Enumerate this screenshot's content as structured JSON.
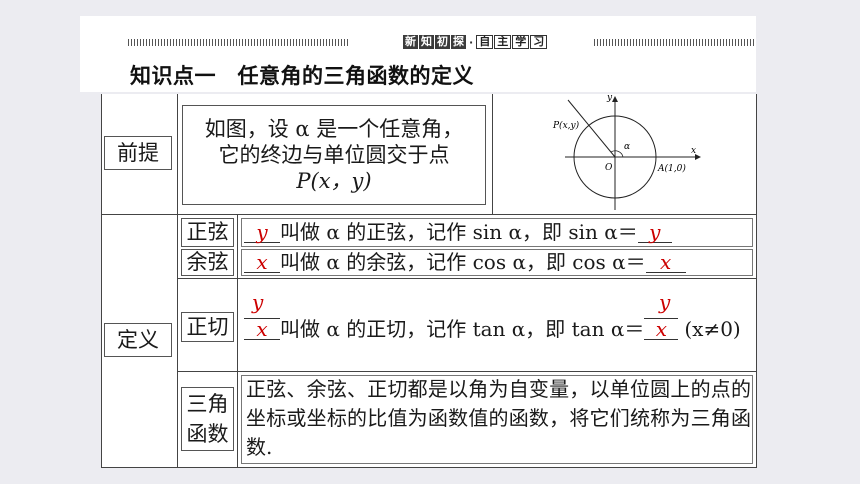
{
  "header": {
    "badge_chars": [
      "新",
      "知",
      "初",
      "探"
    ],
    "separator": "·",
    "subtitle_chars": [
      "自",
      "主",
      "学",
      "习"
    ],
    "title": "知识点一　任意角的三角函数的定义"
  },
  "premise": {
    "label": "前提",
    "line1": "如图，设 α 是一个任意角，",
    "line2": "它的终边与单位圆交于点",
    "line3": "P(x，y)"
  },
  "figure": {
    "y_axis": "y",
    "x_axis": "x",
    "point_p": "P(x,y)",
    "alpha": "α",
    "origin": "O",
    "point_a": "A(1,0)"
  },
  "definition": {
    "label": "定义",
    "sine": {
      "label": "正弦",
      "ans1": "y",
      "mid": "叫做 α 的正弦，记作 sin α，即 sin α＝",
      "ans2": "y"
    },
    "cosine": {
      "label": "余弦",
      "ans1": "x",
      "mid": "叫做 α 的余弦，记作 cos α，即 cos α＝",
      "ans2": "x"
    },
    "tangent": {
      "label": "正切",
      "num1": "y",
      "den1": "x",
      "mid": "叫做 α 的正切，记作 tan α，即 tan α＝",
      "num2": "y",
      "den2": "x",
      "cond": "(x≠0)"
    },
    "trig": {
      "label_l1": "三角",
      "label_l2": "函数",
      "text": "正弦、余弦、正切都是以角为自变量，以单位圆上的点的坐标或坐标的比值为函数值的函数，将它们统称为三角函数."
    }
  },
  "colors": {
    "answer": "#cc0000",
    "border": "#444444",
    "background": "#ececf1"
  }
}
